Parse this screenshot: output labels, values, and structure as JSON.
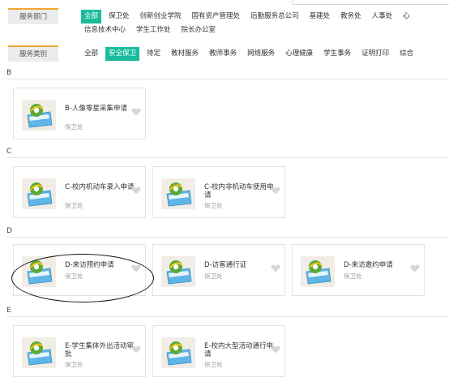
{
  "filters": {
    "department_label": "服务部门",
    "department_items": [
      "全部",
      "保卫处",
      "创新创业学院",
      "国有资产管理处",
      "后勤服务总公司",
      "基建处",
      "教务处",
      "人事处",
      "心"
    ],
    "department_items_line2": [
      "信息技术中心",
      "学生工作处",
      "院长办公室"
    ],
    "category_label": "服务类别",
    "category_items": [
      "全部",
      "安全保卫",
      "待定",
      "教材服务",
      "教师事务",
      "网络服务",
      "心理健康",
      "学生事务",
      "证明打印",
      "综合"
    ]
  },
  "sections": [
    {
      "letter": "B",
      "cards": [
        {
          "title": "B-人像零星采集申请",
          "dept": "保卫处"
        }
      ]
    },
    {
      "letter": "C",
      "cards": [
        {
          "title": "C-校内机动车录入申请",
          "dept": "保卫处"
        },
        {
          "title": "C-校内非机动车使用申请",
          "dept": "保卫处"
        }
      ]
    },
    {
      "letter": "D",
      "cards": [
        {
          "title": "D-来访预约申请",
          "dept": "保卫处"
        },
        {
          "title": "D-访客通行证",
          "dept": "保卫处"
        },
        {
          "title": "D-来访邀约申请",
          "dept": "保卫处"
        }
      ]
    },
    {
      "letter": "E",
      "cards": [
        {
          "title": "E-学生集体外出活动审批",
          "dept": "保卫处"
        },
        {
          "title": "E-校内大型活动通行申请",
          "dept": "保卫处"
        }
      ]
    }
  ],
  "colors": {
    "active_chip": "#1abc9c",
    "label_accent": "#f0a830",
    "icon_folder": "#5fb6e6",
    "icon_globe": "#5aa83a"
  },
  "icons": {
    "service_icon": "ie-folder-icon",
    "favorite_icon": "heart-icon"
  },
  "annotation": "hand-drawn ellipse around D-来访预约申请"
}
